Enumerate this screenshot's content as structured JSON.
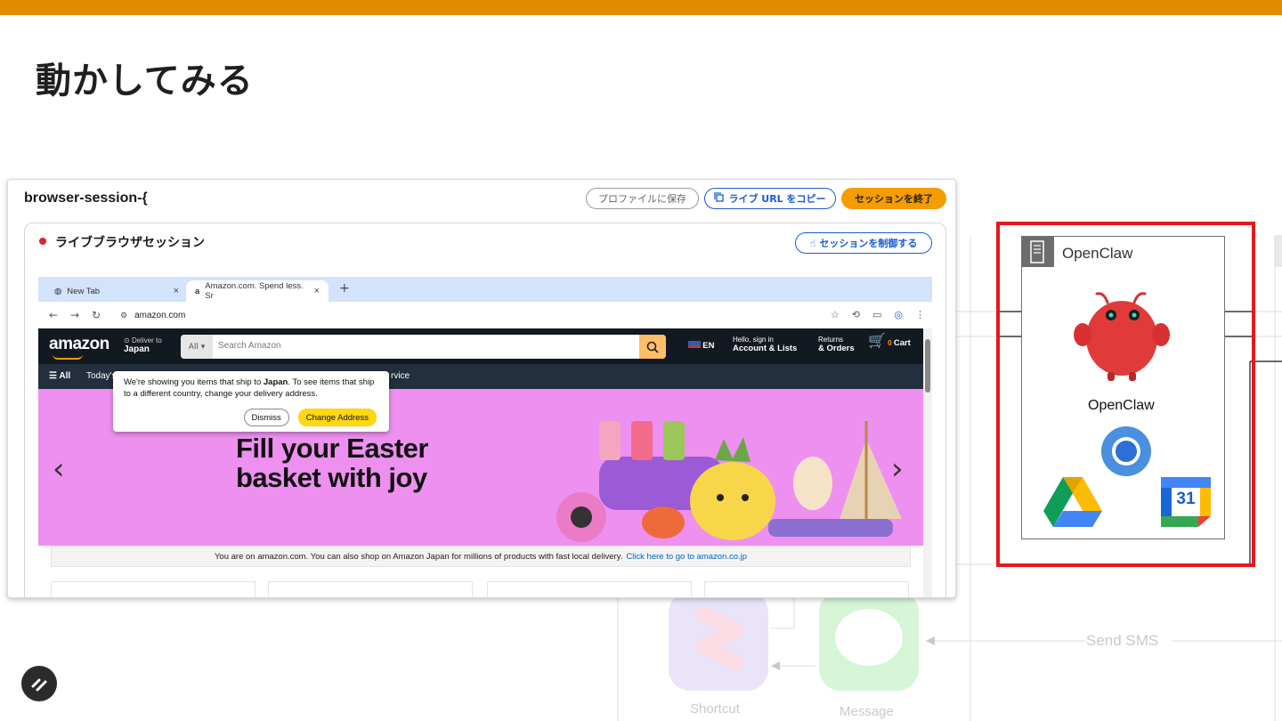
{
  "slide": {
    "title": "動かしてみる"
  },
  "session": {
    "title": "browser-session-{",
    "save_profile": "プロファイルに保存",
    "copy_live_url": "ライブ URL をコピー",
    "end_session": "セッションを終了",
    "live_label": "ライブブラウザセッション",
    "control_session": "セッションを制御する"
  },
  "browser": {
    "tabs": [
      {
        "label": "New Tab"
      },
      {
        "label": "Amazon.com. Spend less. Sr"
      }
    ],
    "url": "amazon.com"
  },
  "amazon": {
    "logo": "amazon",
    "deliver_to": "Deliver to",
    "deliver_location": "Japan",
    "search_category": "All",
    "search_placeholder": "Search Amazon",
    "lang": "EN",
    "account_line1": "Hello, sign in",
    "account_line2": "Account & Lists",
    "orders_line1": "Returns",
    "orders_line2": "& Orders",
    "cart_count": "0",
    "cart": "Cart",
    "nav_all": "All",
    "nav_today": "Today's",
    "nav_service": "rvice",
    "hero_line1": "Fill your Easter",
    "hero_line2": "basket with joy",
    "notice_text": "You are on amazon.com. You can also shop on Amazon Japan for millions of products with fast local delivery.",
    "notice_link": "Click here to go to amazon.co.jp",
    "popup_text_1": "We're showing you items that ship to",
    "popup_text_bold": "Japan",
    "popup_text_2": ". To see items that ship to a different country, change your delivery address.",
    "popup_dismiss": "Dismiss",
    "popup_change": "Change Address"
  },
  "diagram": {
    "box_header": "OpenClaw",
    "character_name": "OpenClaw",
    "calendar_day": "31",
    "bg_send_sms": "Send SMS",
    "bg_shortcut": "Shortcut",
    "bg_message": "Message"
  },
  "colors": {
    "accent_bar": "#e38b00",
    "end_button": "#f59c00",
    "link_blue": "#1a5cd1",
    "frame_red": "#e4181e"
  }
}
